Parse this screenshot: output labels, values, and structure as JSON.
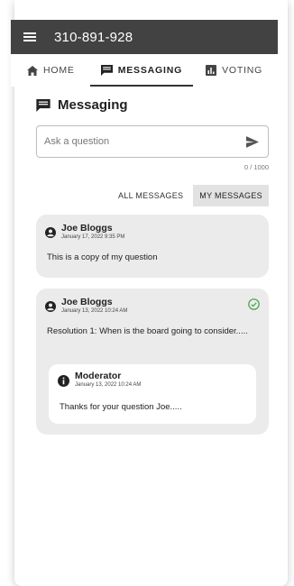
{
  "app": {
    "title": "310-891-928"
  },
  "tabs": [
    {
      "label": "HOME",
      "icon": "home-icon"
    },
    {
      "label": "MESSAGING",
      "icon": "chat-icon",
      "active": true
    },
    {
      "label": "VOTING",
      "icon": "bar-chart-icon"
    }
  ],
  "section": {
    "title": "Messaging"
  },
  "ask": {
    "placeholder": "Ask a question",
    "value": "",
    "counter": "0 / 1000"
  },
  "filters": {
    "all": "ALL MESSAGES",
    "mine": "MY MESSAGES",
    "active": "mine"
  },
  "messages": [
    {
      "author": "Joe Bloggs",
      "date": "January 17, 2022 9:35 PM",
      "text": "This is a copy of my question",
      "answered": false
    },
    {
      "author": "Joe Bloggs",
      "date": "January 13, 2022 10:24 AM",
      "text": "Resolution 1: When is the board going to consider.....",
      "answered": true,
      "reply": {
        "author": "Moderator",
        "date": "January 13, 2022 10:24 AM",
        "text": "Thanks for your question Joe....."
      }
    }
  ],
  "colors": {
    "topbar": "#424242",
    "card": "#ebebeb",
    "accent_green": "#43a047",
    "active_filter": "#e2e2e2"
  }
}
